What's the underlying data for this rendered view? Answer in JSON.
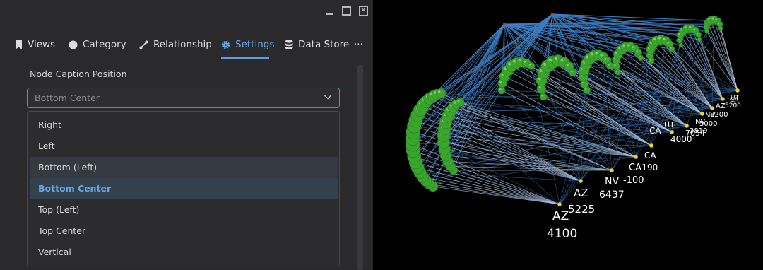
{
  "window_controls": [
    "minimize-icon",
    "maximize-icon",
    "close-icon"
  ],
  "tabs": [
    {
      "label": "Views",
      "icon": "bookmark-icon"
    },
    {
      "label": "Category",
      "icon": "circle-icon"
    },
    {
      "label": "Relationship",
      "icon": "link-icon"
    },
    {
      "label": "Settings",
      "icon": "gear-icon",
      "active": true
    },
    {
      "label": "Data Store",
      "icon": "database-icon"
    }
  ],
  "more_label": "···",
  "settings": {
    "caption_position_label": "Node Caption Position",
    "caption_position_value": "Bottom Center",
    "options": [
      "Right",
      "Left",
      "Bottom (Left)",
      "Bottom Center",
      "Top (Left)",
      "Top Center",
      "Vertical"
    ],
    "hovered_option": "Bottom (Left)",
    "selected_option": "Bottom Center"
  },
  "graph": {
    "node_color": "#3aa52d",
    "edge_color": "#3d7fc4",
    "highlight_edge_color": "#b7c9e4",
    "label_color": "#ffffff",
    "labels": [
      {
        "state": "AZ",
        "value": "4100"
      },
      {
        "state": "AZ",
        "value": "5225"
      },
      {
        "state": "NV",
        "value": "6437"
      },
      {
        "state": "CA",
        "value": "-100"
      },
      {
        "state": "CA",
        "value": "-190"
      },
      {
        "state": "CA",
        "value": "4000"
      },
      {
        "state": "UT",
        "value": "7054"
      },
      {
        "state": "NV",
        "value": "3819"
      },
      {
        "state": "NV",
        "value": "5000"
      },
      {
        "state": "AZ",
        "value": "8200"
      },
      {
        "state": "UT",
        "value": "5200"
      },
      {
        "state": "CA",
        "value": ""
      }
    ]
  }
}
